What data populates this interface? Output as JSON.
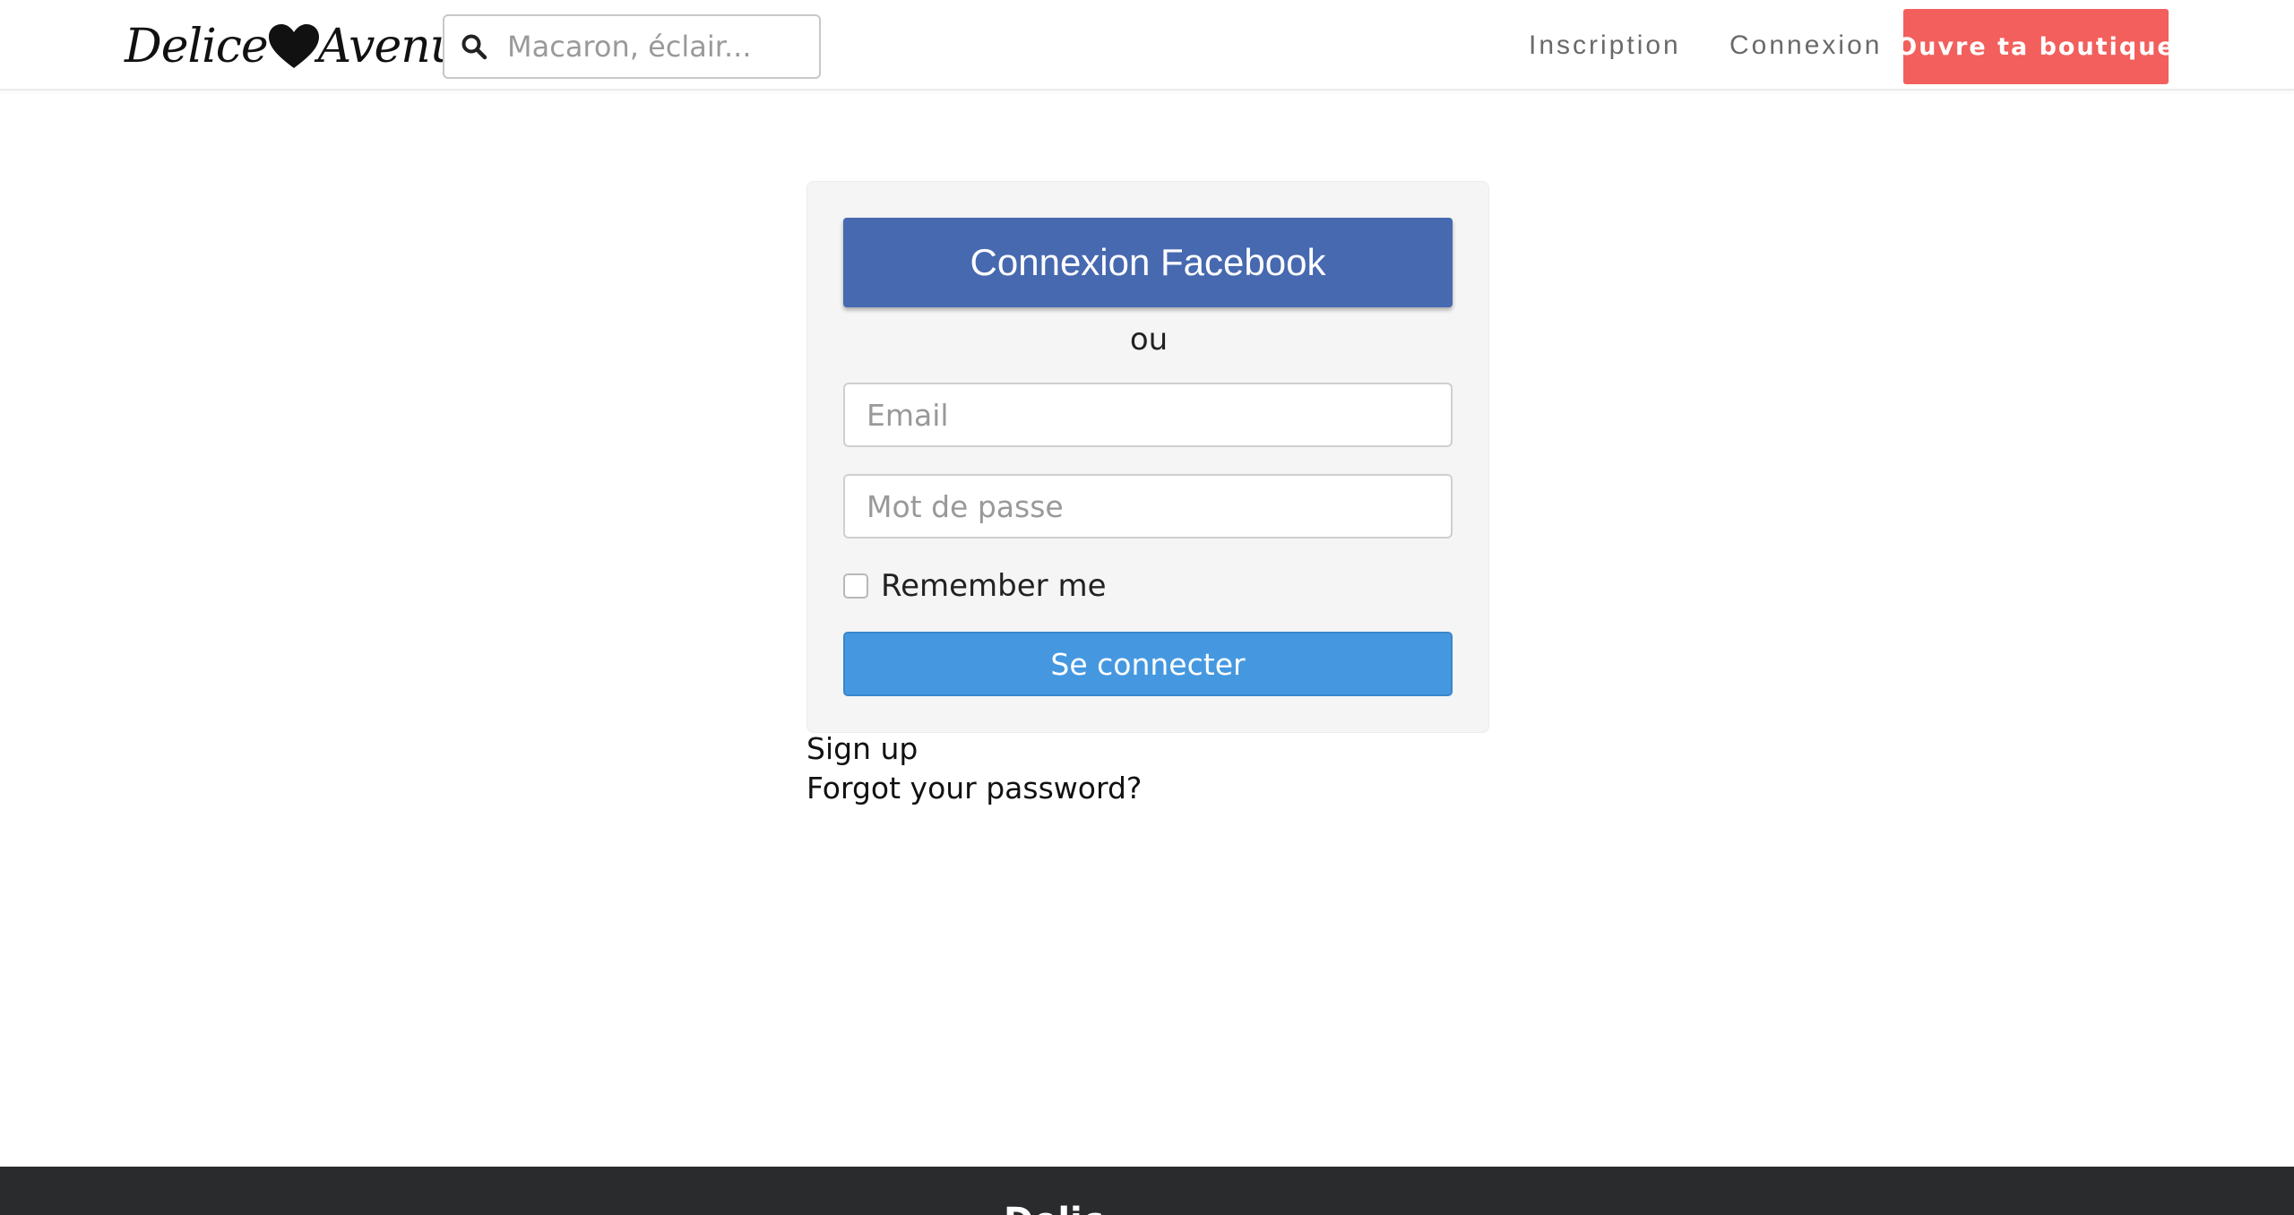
{
  "brand": {
    "name_part1": "Delice",
    "name_part2": "Avenue",
    "heart_icon": "heart-icon"
  },
  "search": {
    "icon": "search-icon",
    "placeholder": "Macaron, éclair..."
  },
  "nav": {
    "inscription": "Inscription",
    "connexion": "Connexion",
    "shop_button": "Ouvre ta boutique"
  },
  "login": {
    "facebook_button": "Connexion Facebook",
    "separator": "ou",
    "email_placeholder": "Email",
    "password_placeholder": "Mot de passe",
    "remember_label": "Remember me",
    "submit_button": "Se connecter"
  },
  "links": {
    "sign_up": "Sign up",
    "forgot_password": "Forgot your password?"
  },
  "footer": {
    "title": "Delic"
  },
  "colors": {
    "shop_button": "#f25f5c",
    "facebook": "#4769b0",
    "submit": "#4598e0",
    "footer_bg": "#2a2b2d"
  }
}
